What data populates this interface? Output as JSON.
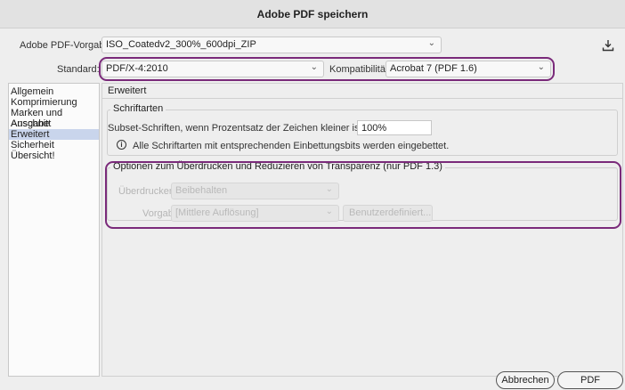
{
  "window": {
    "title": "Adobe PDF speichern"
  },
  "preset": {
    "label": "Adobe PDF-Vorgabe:",
    "value": "ISO_Coatedv2_300%_600dpi_ZIP"
  },
  "standard": {
    "label": "Standard:",
    "value": "PDF/X-4:2010"
  },
  "compatibility": {
    "label": "Kompatibilität:",
    "value": "Acrobat 7 (PDF 1.6)"
  },
  "sidebar": {
    "items": [
      {
        "label": "Allgemein"
      },
      {
        "label": "Komprimierung"
      },
      {
        "label": "Marken und Anschnitt"
      },
      {
        "label": "Ausgabe"
      },
      {
        "label": "Erweitert"
      },
      {
        "label": "Sicherheit"
      },
      {
        "label": "Übersicht!"
      }
    ],
    "active_index": 4
  },
  "panel": {
    "title": "Erweitert",
    "fonts": {
      "legend": "Schriftarten",
      "subset_label": "Subset-Schriften, wenn Prozentsatz der Zeichen kleiner ist als:",
      "subset_value": "100%",
      "info_text": "Alle Schriftarten mit entsprechenden Einbettungsbits werden eingebettet."
    },
    "transparency": {
      "legend": "Optionen zum Überdrucken und Reduzieren von Transparenz (nur PDF 1.3)",
      "overprint_label": "Überdrucken:",
      "overprint_value": "Beibehalten",
      "preset_label": "Vorgabe:",
      "preset_value": "[Mittlere Auflösung]",
      "custom_button": "Benutzerdefiniert..."
    }
  },
  "footer": {
    "cancel_label": "Abbrechen",
    "save_label": "PDF speichern"
  },
  "colors": {
    "highlight": "#7a2a7a",
    "sidebar_selected": "#c9d5ec"
  }
}
